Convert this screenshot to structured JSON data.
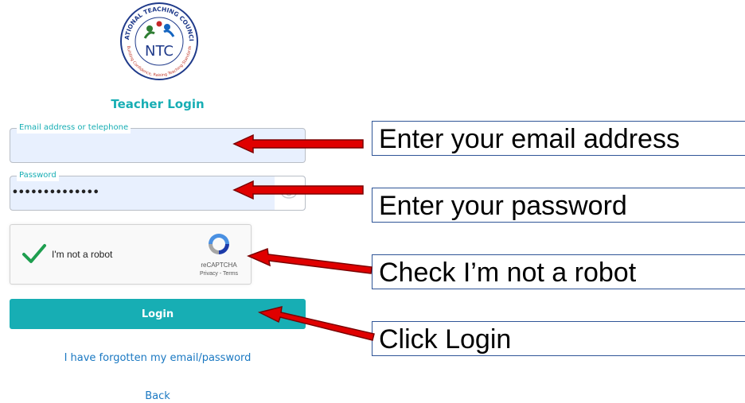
{
  "logo": {
    "ring_text_top": "NATIONAL TEACHING COUNCIL",
    "ring_text_bottom": "Building Confidence, Raising Teaching Standards",
    "acronym": "NTC"
  },
  "form": {
    "title": "Teacher Login",
    "email": {
      "label": "Email address or telephone",
      "value": ""
    },
    "password": {
      "label": "Password",
      "value": "••••••••••••••"
    },
    "captcha": {
      "label": "I'm not a robot",
      "brand": "reCAPTCHA",
      "links": "Privacy - Terms",
      "checked": true
    },
    "login_label": "Login",
    "forgot_label": "I have forgotten my email/password",
    "back_label": "Back"
  },
  "annotations": {
    "email": "Enter your email address",
    "password": "Enter your password",
    "robot": "Check I’m not a robot",
    "login": "Click Login"
  },
  "colors": {
    "accent": "#17aeb4",
    "link": "#1a78c2",
    "arrow": "#e00000",
    "callout_border": "#2f5597"
  }
}
